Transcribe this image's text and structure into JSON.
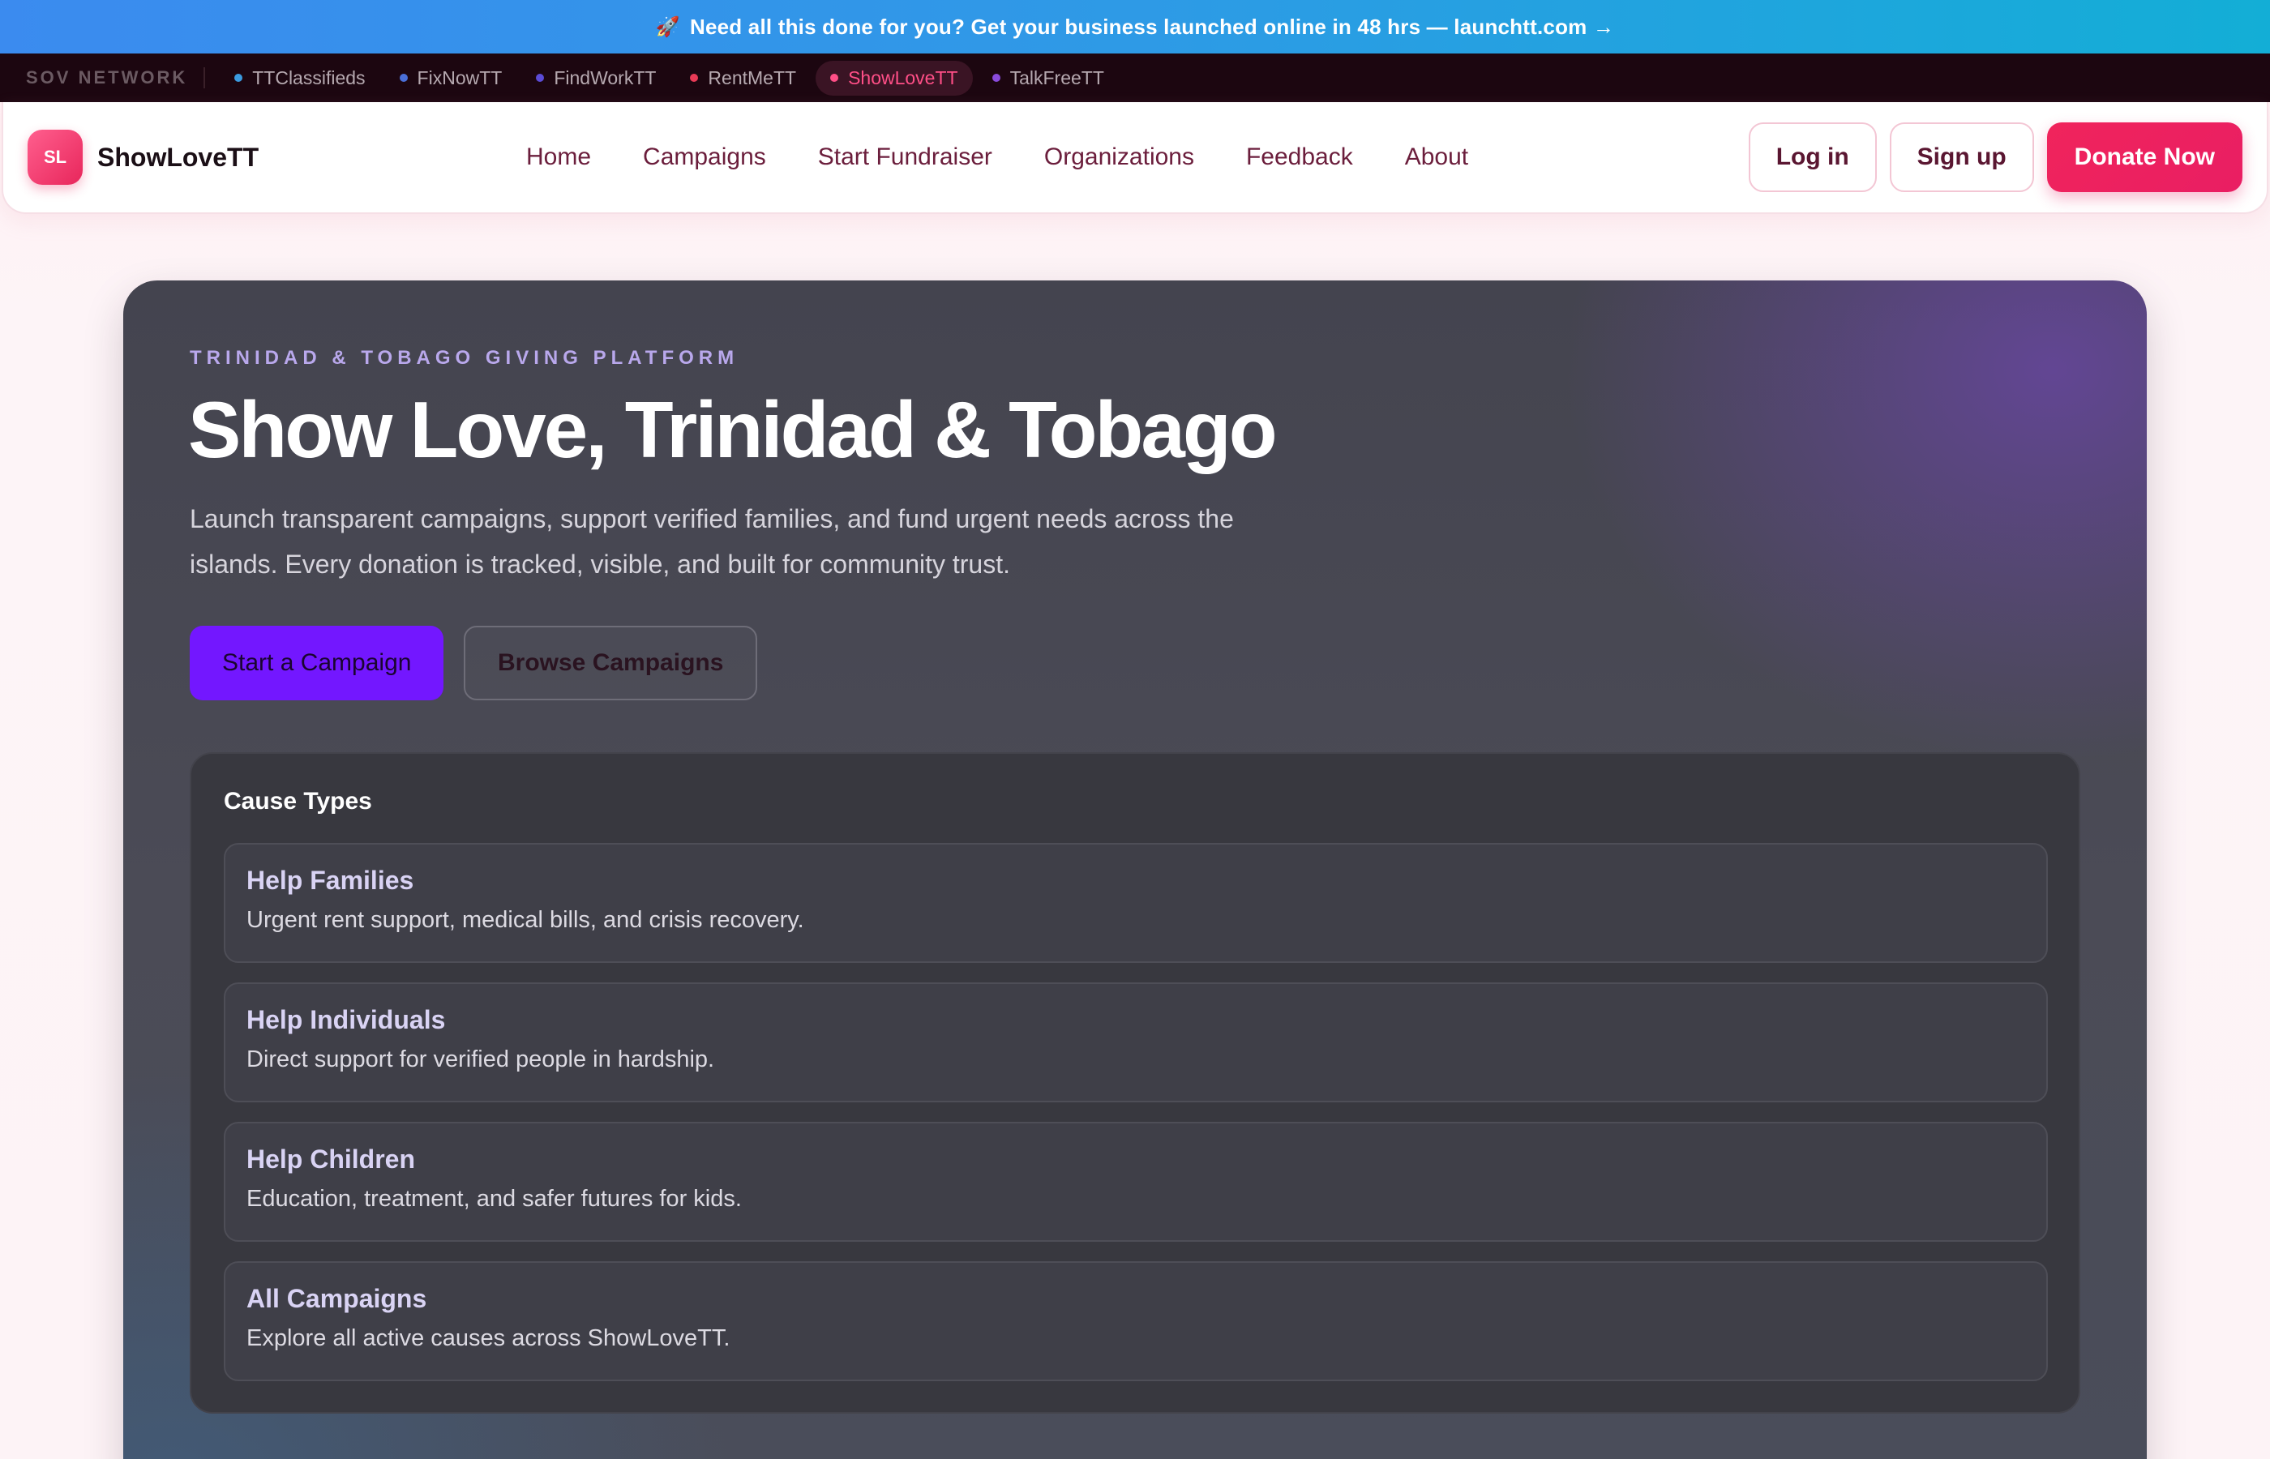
{
  "promo": {
    "rocket": "🚀",
    "text": "Need all this done for you? Get your business launched online in 48 hrs — launchtt.com →"
  },
  "network": {
    "label": "SOV NETWORK",
    "items": [
      {
        "label": "TTClassifieds",
        "dot": "#3b9be0"
      },
      {
        "label": "FixNowTT",
        "dot": "#4a6fd8"
      },
      {
        "label": "FindWorkTT",
        "dot": "#5b4bd6"
      },
      {
        "label": "RentMeTT",
        "dot": "#e83a56"
      },
      {
        "label": "ShowLoveTT",
        "dot": "#ff4f87",
        "active": true
      },
      {
        "label": "TalkFreeTT",
        "dot": "#8a4bdc"
      }
    ]
  },
  "header": {
    "logo": "SL",
    "brand": "ShowLoveTT",
    "nav": [
      "Home",
      "Campaigns",
      "Start Fundraiser",
      "Organizations",
      "Feedback",
      "About"
    ],
    "login": "Log in",
    "signup": "Sign up",
    "donate": "Donate Now"
  },
  "hero": {
    "eyebrow": "TRINIDAD & TOBAGO GIVING PLATFORM",
    "title": "Show Love, Trinidad & Tobago",
    "lede": "Launch transparent campaigns, support verified families, and fund urgent needs across the islands. Every donation is tracked, visible, and built for community trust.",
    "primary_cta": "Start a Campaign",
    "secondary_cta": "Browse Campaigns"
  },
  "causes": {
    "title": "Cause Types",
    "items": [
      {
        "title": "Help Families",
        "desc": "Urgent rent support, medical bills, and crisis recovery."
      },
      {
        "title": "Help Individuals",
        "desc": "Direct support for verified people in hardship."
      },
      {
        "title": "Help Children",
        "desc": "Education, treatment, and safer futures for kids."
      },
      {
        "title": "All Campaigns",
        "desc": "Explore all active causes across ShowLoveTT."
      }
    ]
  }
}
